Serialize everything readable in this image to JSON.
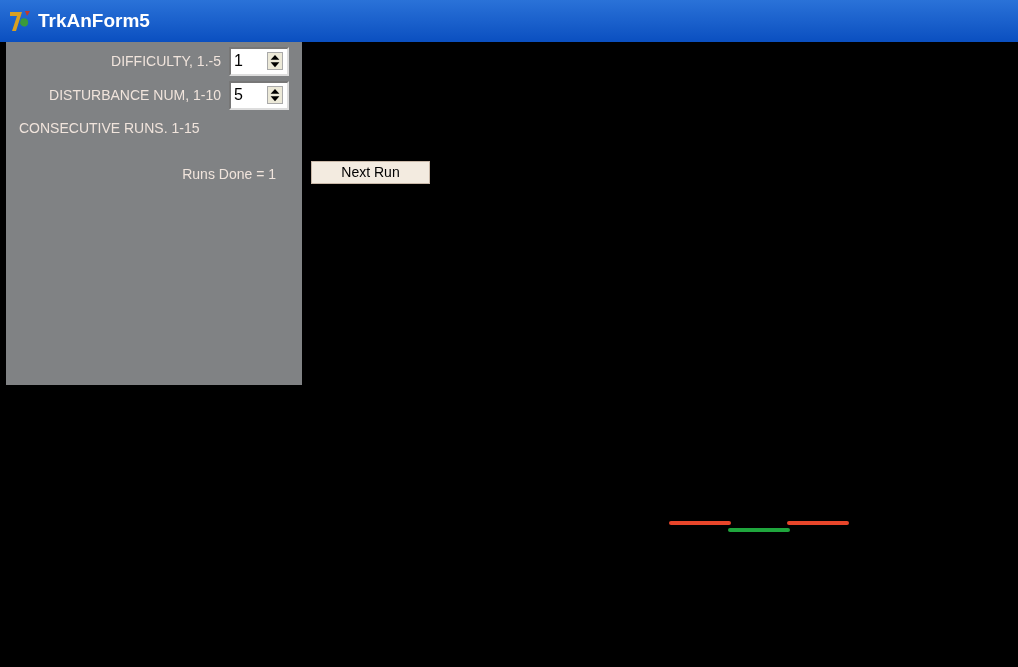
{
  "window": {
    "title": "TrkAnForm5"
  },
  "settings": [
    {
      "label": "DIFFICULTY, 1.-5",
      "value": "1"
    },
    {
      "label": "DISTURBANCE NUM, 1-10",
      "value": "5"
    }
  ],
  "consecutive_label": "CONSECUTIVE RUNS. 1-15",
  "runs_done": "Runs Done = 1",
  "next_button": "Next Run"
}
